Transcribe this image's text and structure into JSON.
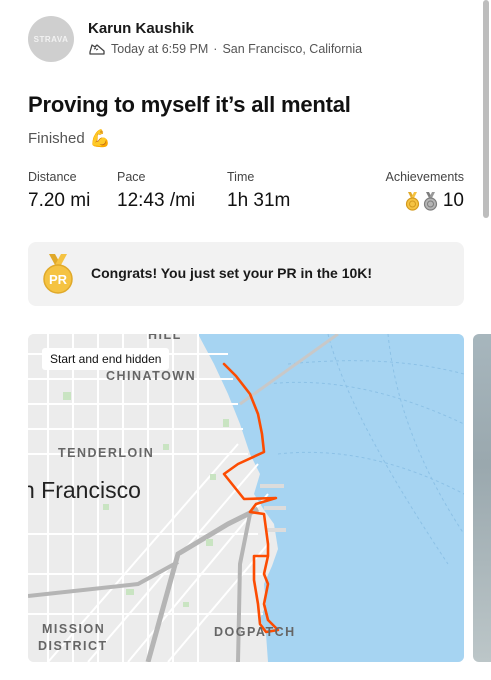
{
  "header": {
    "avatar_text": "STRAVA",
    "athlete_name": "Karun Kaushik",
    "timestamp": "Today at 6:59 PM",
    "separator": "·",
    "location": "San Francisco, California"
  },
  "activity": {
    "title": "Proving to myself it’s all mental",
    "status": "Finished",
    "status_emoji": "💪"
  },
  "stats": {
    "distance": {
      "label": "Distance",
      "value": "7.20 mi"
    },
    "pace": {
      "label": "Pace",
      "value": "12:43 /mi"
    },
    "time": {
      "label": "Time",
      "value": "1h 31m"
    },
    "achievements": {
      "label": "Achievements",
      "count": "10"
    }
  },
  "pr_banner": {
    "badge_text": "PR",
    "message": "Congrats! You just set your PR in the 10K!"
  },
  "map": {
    "privacy_tag": "Start and end hidden",
    "labels": {
      "hill": "HILL",
      "chinatown": "CHINATOWN",
      "tenderloin": "TENDERLOIN",
      "city": "n Francisco",
      "mission": "MISSION",
      "district": "DISTRICT",
      "dogpatch": "DOGPATCH"
    },
    "route_color": "#fc4c02",
    "water_color": "#a6d4f2"
  },
  "colors": {
    "accent": "#fc4c02",
    "gold": "#f5c342",
    "silver": "#9a9a9a",
    "banner_bg": "#f2f2f2"
  }
}
